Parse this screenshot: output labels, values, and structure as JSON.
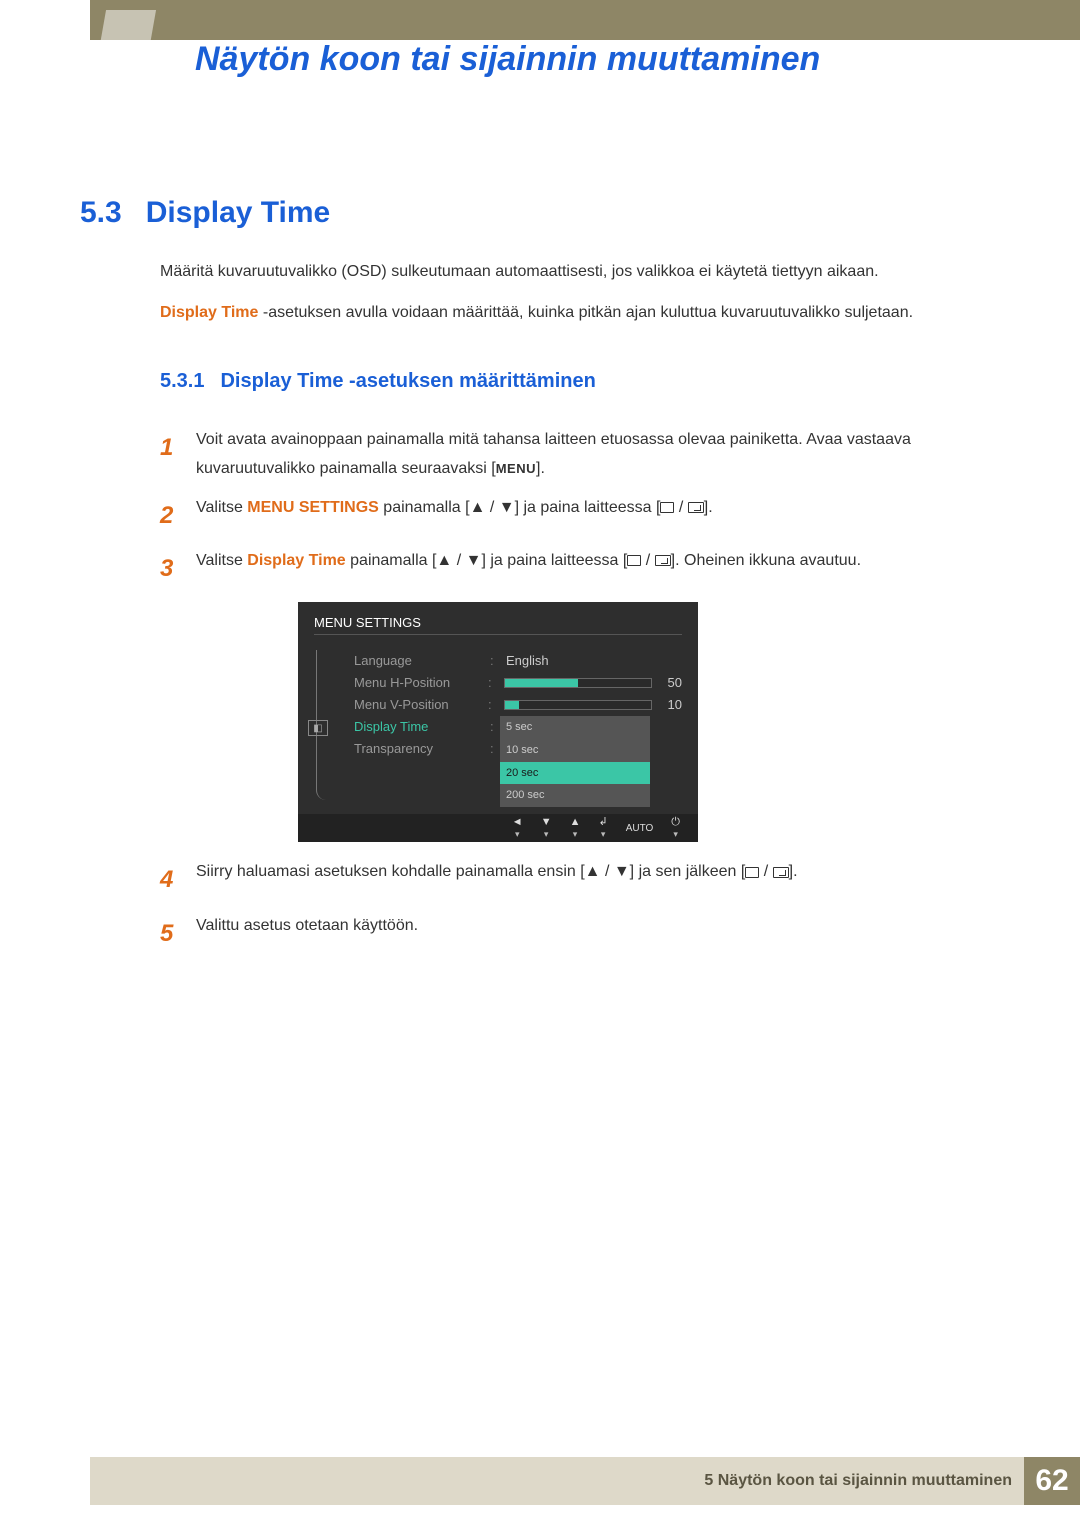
{
  "chapter_title": "Näytön koon tai sijainnin muuttaminen",
  "section": {
    "number": "5.3",
    "title": "Display Time"
  },
  "intro_paragraphs": {
    "p1": "Määritä kuvaruutuvalikko (OSD) sulkeutumaan automaattisesti, jos valikkoa ei käytetä tiettyyn aikaan.",
    "p2_prefix": "Display Time",
    "p2_rest": " -asetuksen avulla voidaan määrittää, kuinka pitkän ajan kuluttua kuvaruutuvalikko suljetaan."
  },
  "subsection": {
    "number": "5.3.1",
    "title": "Display Time -asetuksen määrittäminen"
  },
  "steps": {
    "s1a": "Voit avata avainoppaan painamalla mitä tahansa laitteen etuosassa olevaa painiketta. Avaa vastaava kuvaruutuvalikko painamalla seuraavaksi [",
    "s1_menu": "MENU",
    "s1b": "].",
    "s2a": "Valitse ",
    "s2_bold": "MENU SETTINGS",
    "s2b": " painamalla [",
    "s2c": "] ja paina laitteessa [",
    "s2d": "].",
    "s3a": "Valitse ",
    "s3_bold": "Display Time",
    "s3b": " painamalla [",
    "s3c": "] ja paina laitteessa [",
    "s3d": "]. Oheinen ikkuna avautuu.",
    "s4a": "Siirry haluamasi asetuksen kohdalle painamalla ensin [",
    "s4b": "] ja sen jälkeen [",
    "s4c": "].",
    "s5": "Valittu asetus otetaan käyttöön."
  },
  "osd": {
    "title": "MENU SETTINGS",
    "rows": {
      "language": {
        "label": "Language",
        "value": "English"
      },
      "h_pos": {
        "label": "Menu H-Position",
        "value": 50,
        "pct": 50
      },
      "v_pos": {
        "label": "Menu V-Position",
        "value": 10,
        "pct": 10
      },
      "display_time": {
        "label": "Display Time"
      },
      "transparency": {
        "label": "Transparency"
      }
    },
    "dropdown": [
      "5 sec",
      "10 sec",
      "20 sec",
      "200 sec"
    ],
    "dropdown_selected_index": 2,
    "bottom_auto": "AUTO"
  },
  "footer": {
    "text": "5 Näytön koon tai sijainnin muuttaminen",
    "page": "62"
  }
}
